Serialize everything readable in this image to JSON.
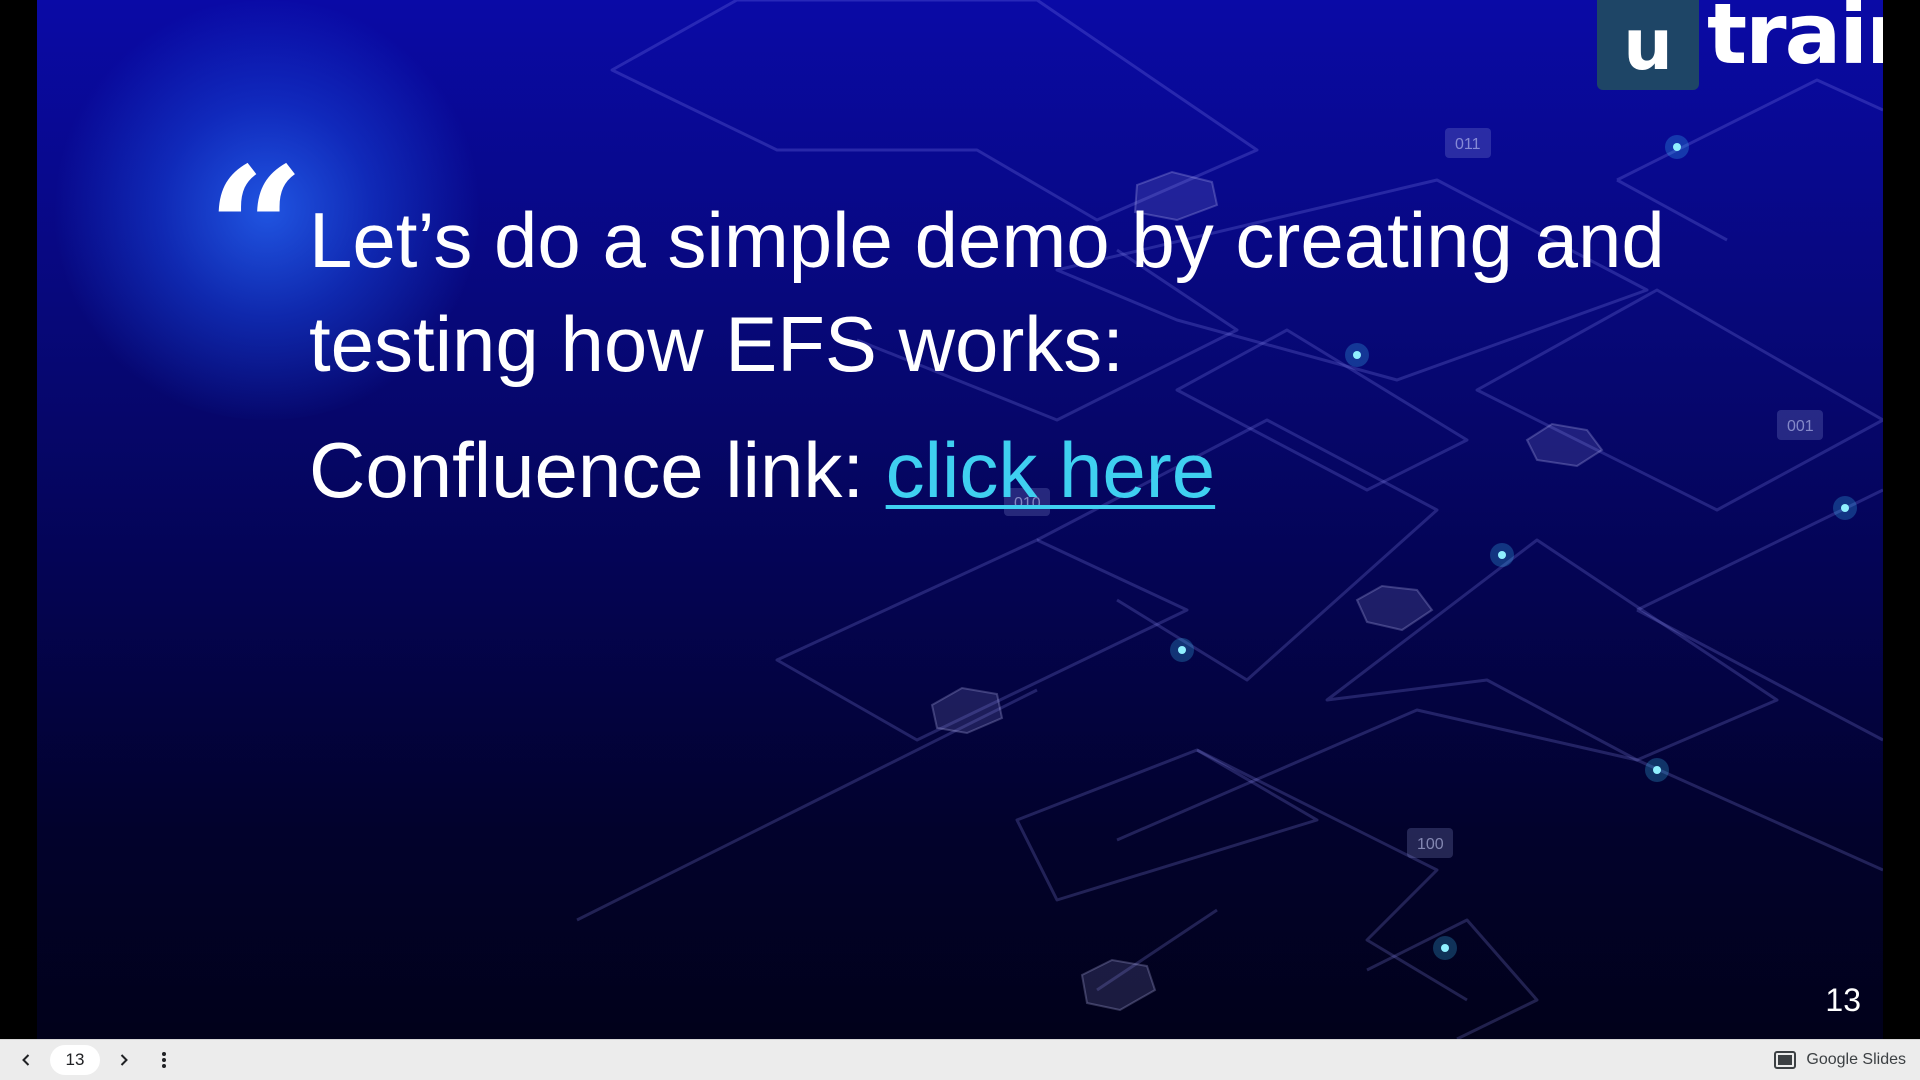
{
  "slide": {
    "quote_mark": "“",
    "headline": "Let’s do a simple demo by creating and testing how EFS works:",
    "link_prefix": "Confluence link: ",
    "link_text": "click here",
    "slide_number": "13",
    "logo_box_letter": "u",
    "logo_text": "train",
    "binary_tags": [
      "011",
      "001",
      "010",
      "100"
    ]
  },
  "toolbar": {
    "current_page": "13",
    "brand_label": "Google Slides"
  },
  "colors": {
    "link": "#3fd0f0",
    "logo_box": "#1e4566",
    "background_top": "#0a0aa6",
    "background_bottom": "#01011a"
  },
  "icons": {
    "prev": "chevron-left-icon",
    "next": "chevron-right-icon",
    "more": "more-vertical-icon",
    "brand": "slides-icon"
  }
}
